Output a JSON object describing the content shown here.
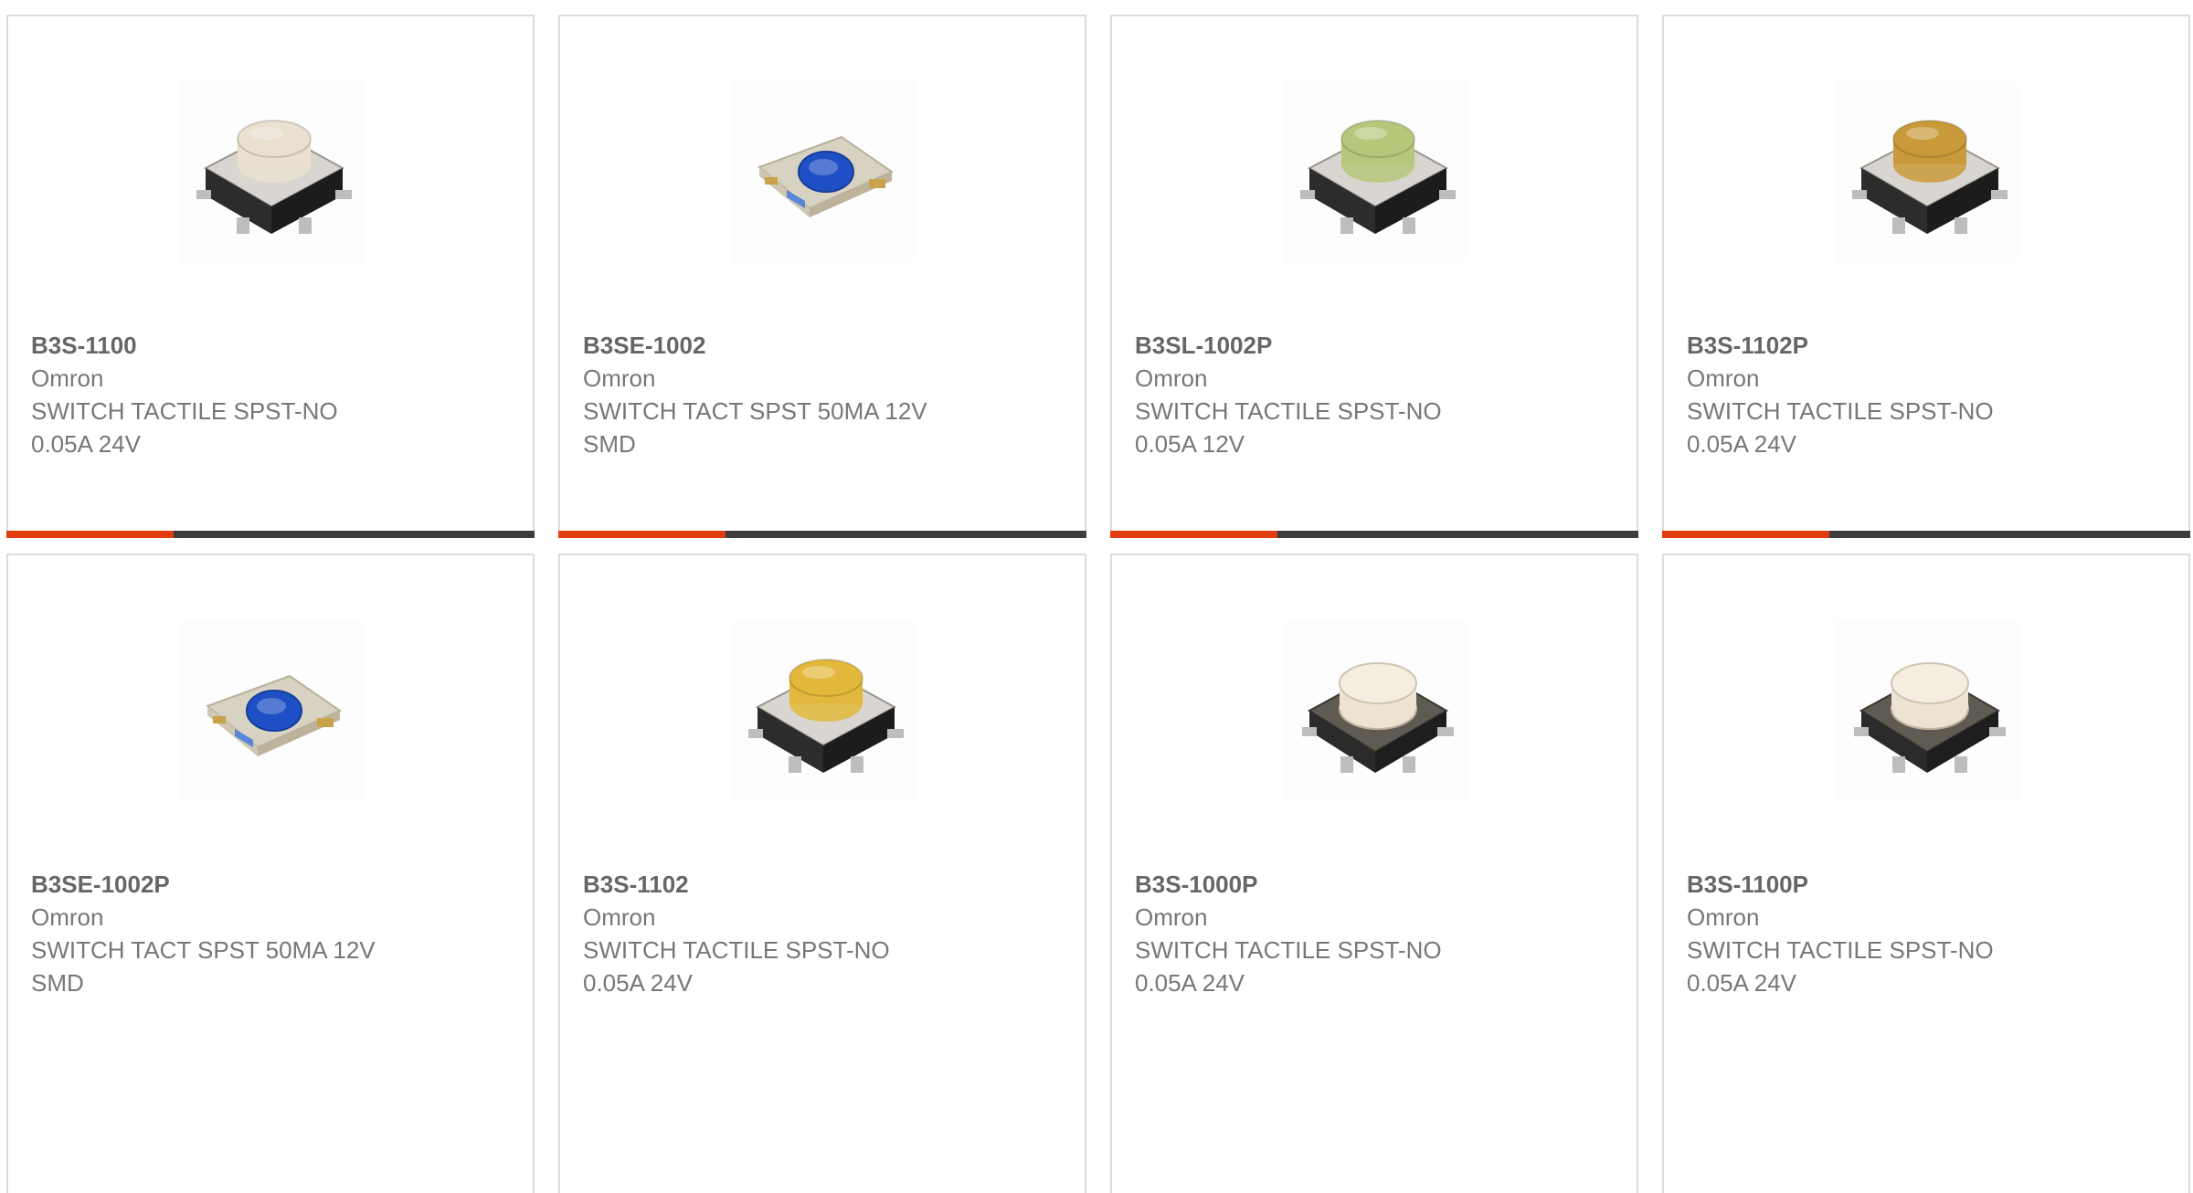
{
  "accent_color": "#e23c10",
  "bar_color": "#3d3d3d",
  "products": [
    {
      "part": "B3S-1100",
      "brand": "Omron",
      "desc_line1": "SWITCH TACTILE SPST-NO",
      "desc_line2": "0.05A 24V",
      "image_icon": "tactile-switch-large-icon",
      "actuator_color": "#e9e0cf"
    },
    {
      "part": "B3SE-1002",
      "brand": "Omron",
      "desc_line1": "SWITCH TACT SPST 50MA 12V",
      "desc_line2": "SMD",
      "image_icon": "tactile-switch-smd-icon",
      "actuator_color": "#1f4fc4"
    },
    {
      "part": "B3SL-1002P",
      "brand": "Omron",
      "desc_line1": "SWITCH TACTILE SPST-NO",
      "desc_line2": "0.05A 12V",
      "image_icon": "tactile-switch-large-icon",
      "actuator_color": "#b5c77b"
    },
    {
      "part": "B3S-1102P",
      "brand": "Omron",
      "desc_line1": "SWITCH TACTILE SPST-NO",
      "desc_line2": "0.05A 24V",
      "image_icon": "tactile-switch-large-icon",
      "actuator_color": "#c99a3a"
    },
    {
      "part": "B3SE-1002P",
      "brand": "Omron",
      "desc_line1": "SWITCH TACT SPST 50MA 12V",
      "desc_line2": "SMD",
      "image_icon": "tactile-switch-smd-icon",
      "actuator_color": "#1f4fc4"
    },
    {
      "part": "B3S-1102",
      "brand": "Omron",
      "desc_line1": "SWITCH TACTILE SPST-NO",
      "desc_line2": "0.05A 24V",
      "image_icon": "tactile-switch-large-icon",
      "actuator_color": "#e2b83c"
    },
    {
      "part": "B3S-1000P",
      "brand": "Omron",
      "desc_line1": "SWITCH TACTILE SPST-NO",
      "desc_line2": "0.05A 24V",
      "image_icon": "tactile-switch-dark-icon",
      "actuator_color": "#ede3d1"
    },
    {
      "part": "B3S-1100P",
      "brand": "Omron",
      "desc_line1": "SWITCH TACTILE SPST-NO",
      "desc_line2": "0.05A 24V",
      "image_icon": "tactile-switch-dark-icon",
      "actuator_color": "#ede3d1"
    }
  ]
}
